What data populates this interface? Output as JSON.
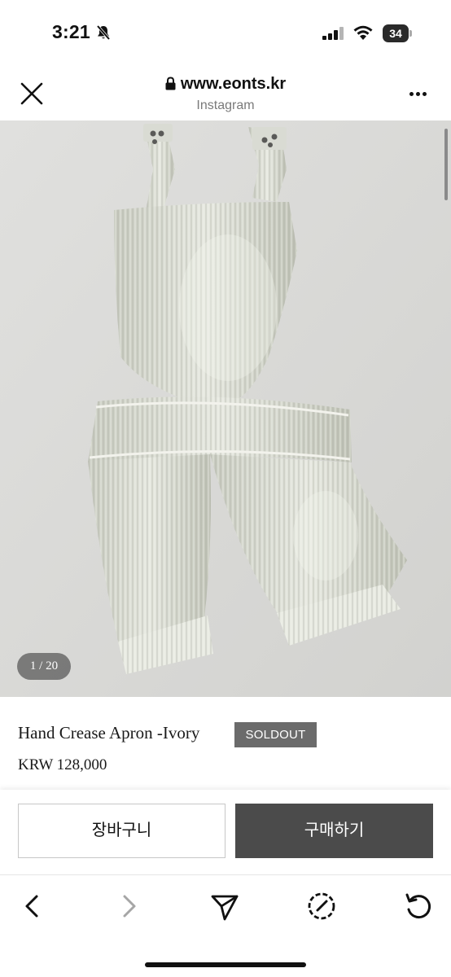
{
  "status_bar": {
    "time": "3:21",
    "battery_level": "34",
    "icons": [
      "bell-slash-icon",
      "signal-icon",
      "wifi-icon",
      "battery-icon"
    ]
  },
  "browser": {
    "url": "www.eonts.kr",
    "source": "Instagram",
    "icons": [
      "close-icon",
      "lock-icon",
      "more-icon"
    ]
  },
  "gallery": {
    "page_indicator": "1 / 20"
  },
  "product": {
    "title": "Hand Crease Apron -Ivory",
    "badge": "SOLDOUT",
    "price": "KRW 128,000"
  },
  "actions": {
    "cart_label": "장바구니",
    "buy_label": "구매하기"
  },
  "toolbar": {
    "icons": [
      "back-icon",
      "forward-icon",
      "share-icon",
      "compass-icon",
      "reload-icon"
    ]
  },
  "colors": {
    "badge_bg": "#6b6b6b",
    "buy_button_bg": "#4b4b4b",
    "image_bg": "#dadad8"
  }
}
